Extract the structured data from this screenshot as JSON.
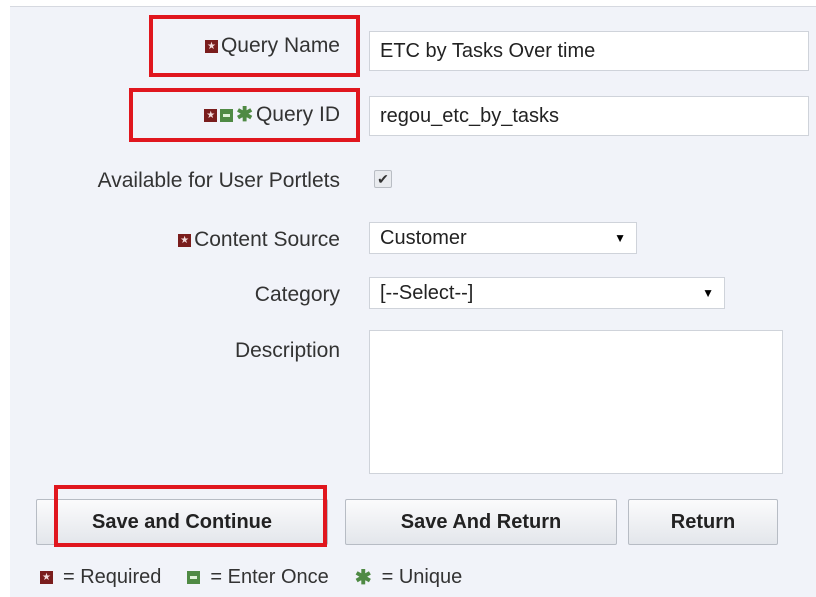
{
  "form": {
    "query_name": {
      "label": "Query Name",
      "value": "ETC by Tasks Over time"
    },
    "query_id": {
      "label": "Query ID",
      "value": "regou_etc_by_tasks"
    },
    "available_portlets": {
      "label": "Available for User Portlets",
      "checked_glyph": "✔"
    },
    "content_source": {
      "label": "Content Source",
      "value": "Customer"
    },
    "category": {
      "label": "Category",
      "value": "[--Select--]"
    },
    "description": {
      "label": "Description",
      "value": ""
    }
  },
  "buttons": {
    "save_continue": "Save and Continue",
    "save_return": "Save And Return",
    "return": "Return"
  },
  "legend": {
    "required": "= Required",
    "enter_once": "= Enter Once",
    "unique": "= Unique"
  },
  "icons": {
    "required": "required-icon",
    "enter_once": "enter-once-icon",
    "unique": "unique-icon",
    "caret": "▼"
  },
  "colors": {
    "required": "#7a1d1d",
    "enter_once": "#4f8a44",
    "highlight": "#e0161e",
    "panel": "#f1f3f9"
  }
}
